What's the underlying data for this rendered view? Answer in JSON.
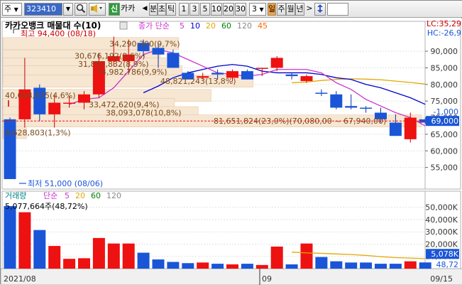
{
  "toolbar": {
    "market": "주",
    "code": "323410",
    "search_icon": "magnifier-icon",
    "speaker_icon": "speaker-icon",
    "new_badge": "신",
    "stock_name": "카카",
    "prev_arrow": "◀",
    "period_label": "분",
    "tick_label": "초",
    "tick2_label": "틱",
    "periods": [
      "1",
      "3",
      "5",
      "10",
      "20",
      "30"
    ],
    "count": "3",
    "day_label": "일",
    "week_label": "주",
    "month_label": "월",
    "year_label": "년",
    "next_arrow": ">",
    "updown_icon": "updown-arrow-icon"
  },
  "price_panel": {
    "title": "카카오뱅크 매물대 수(10)",
    "ma_label": "종가 단순",
    "ma_periods": [
      "5",
      "10",
      "20",
      "60",
      "120",
      "45"
    ],
    "ma_colors": [
      "#cc33cc",
      "#0000cc",
      "#e3a800",
      "#008000",
      "#888888",
      "#ff6600"
    ],
    "high_label": "최고 94,400 (08/18)",
    "low_label": "최저 51,000 (08/06)",
    "lc_label": "LC:35,29",
    "hc_label": "HC:-26,9",
    "cur_price": "69,000",
    "cur_diff": "-1,000",
    "cur_price_pct": "1,000"
  },
  "volume_profile": [
    {
      "label": "34,290,300(9,7%)",
      "value": 34290300,
      "price": 92300
    },
    {
      "label": "30,676,192(8,6%)",
      "value": 30676192,
      "price": 88600
    },
    {
      "label": "31,850,832(8,9%)",
      "value": 31850832,
      "price": 86200
    },
    {
      "label": "34,982,786(9,9%)",
      "value": 34982786,
      "price": 83800
    },
    {
      "label": "48,821,243(13,8%)",
      "value": 48821243,
      "price": 81000
    },
    {
      "label": "40,608,675(4,6%)",
      "value": 40608675,
      "price": 76700
    },
    {
      "label": "33,472,620(9,4%)",
      "value": 33472620,
      "price": 74000
    },
    {
      "label": "38,093,078(10,8%)",
      "value": 38093078,
      "price": 71500
    },
    {
      "label": "81,651,824(23,0%)(70,080,00 ~ 67,940,00)",
      "value": 81651824,
      "price": 69000
    },
    {
      "label": "4,628,803(1,3%)",
      "value": 4628803,
      "price": 65500
    }
  ],
  "volume_panel": {
    "title": "거래량",
    "ma_label": "단순",
    "ma_periods": [
      "5",
      "20",
      "60",
      "120"
    ],
    "ma_colors": [
      "#cc33cc",
      "#e3a800",
      "#008000",
      "#888888"
    ],
    "max_label": "5,077,664주(48,72%)",
    "cur_volume": "5,078K",
    "cur_pct": "48,72"
  },
  "x_axis": {
    "labels": [
      "2021/08",
      "09",
      "09/15"
    ]
  },
  "chart_data": {
    "type": "candlestick",
    "price_ticks": [
      "90,000",
      "85,000",
      "80,000",
      "75,000",
      "70,000",
      "65,000",
      "60,000",
      "55,000"
    ],
    "price_tick_values": [
      90000,
      85000,
      80000,
      75000,
      70000,
      65000,
      60000,
      55000
    ],
    "ylim_price": [
      51000,
      95500
    ],
    "volume_ticks": [
      "50,000K",
      "40,000K",
      "30,000K",
      "20,000K",
      "10,000K"
    ],
    "volume_tick_values": [
      50000,
      40000,
      30000,
      20000,
      10000
    ],
    "ylim_volume": [
      0,
      55000
    ],
    "candles": [
      {
        "o": 69500,
        "h": 70000,
        "l": 53000,
        "c": 51500,
        "v": 51000,
        "up": false
      },
      {
        "o": 69500,
        "h": 88000,
        "l": 67000,
        "c": 78500,
        "v": 46000,
        "up": true
      },
      {
        "o": 79000,
        "h": 80000,
        "l": 69000,
        "c": 71000,
        "v": 31500,
        "up": false
      },
      {
        "o": 71000,
        "h": 77000,
        "l": 67000,
        "c": 74500,
        "v": 18500,
        "up": true
      },
      {
        "o": 74500,
        "h": 76500,
        "l": 73000,
        "c": 74500,
        "v": 8000,
        "up": true
      },
      {
        "o": 74500,
        "h": 78000,
        "l": 72500,
        "c": 77000,
        "v": 8500,
        "up": true
      },
      {
        "o": 77000,
        "h": 89500,
        "l": 76000,
        "c": 87000,
        "v": 25000,
        "up": true
      },
      {
        "o": 87000,
        "h": 94400,
        "l": 85500,
        "c": 88500,
        "v": 20500,
        "up": true
      },
      {
        "o": 87000,
        "h": 93500,
        "l": 83500,
        "c": 89000,
        "v": 20500,
        "up": true
      },
      {
        "o": 92500,
        "h": 93500,
        "l": 88500,
        "c": 90000,
        "v": 13000,
        "up": false
      },
      {
        "o": 91000,
        "h": 92500,
        "l": 85000,
        "c": 89000,
        "v": 7500,
        "up": false
      },
      {
        "o": 89500,
        "h": 90500,
        "l": 85000,
        "c": 85000,
        "v": 5500,
        "up": false
      },
      {
        "o": 83500,
        "h": 84000,
        "l": 81500,
        "c": 81500,
        "v": 4500,
        "up": false
      },
      {
        "o": 82000,
        "h": 83500,
        "l": 81500,
        "c": 82500,
        "v": 5000,
        "up": true
      },
      {
        "o": 83500,
        "h": 84500,
        "l": 81500,
        "c": 83000,
        "v": 4000,
        "up": false
      },
      {
        "o": 82000,
        "h": 84500,
        "l": 81000,
        "c": 84000,
        "v": 3500,
        "up": true
      },
      {
        "o": 84000,
        "h": 84500,
        "l": 81500,
        "c": 81500,
        "v": 4000,
        "up": false
      },
      {
        "o": 85000,
        "h": 85000,
        "l": 82500,
        "c": 85000,
        "v": 3000,
        "up": true
      },
      {
        "o": 85000,
        "h": 88500,
        "l": 84000,
        "c": 88000,
        "v": 18000,
        "up": true
      },
      {
        "o": 83000,
        "h": 83500,
        "l": 81500,
        "c": 82500,
        "v": 3500,
        "up": false
      },
      {
        "o": 81000,
        "h": 83000,
        "l": 80500,
        "c": 82500,
        "v": 20500,
        "up": true
      },
      {
        "o": 77500,
        "h": 78500,
        "l": 76500,
        "c": 77500,
        "v": 9500,
        "up": false
      },
      {
        "o": 77000,
        "h": 78000,
        "l": 72500,
        "c": 73000,
        "v": 6000,
        "up": false
      },
      {
        "o": 73000,
        "h": 77000,
        "l": 72500,
        "c": 73500,
        "v": 5000,
        "up": false
      },
      {
        "o": 73000,
        "h": 73500,
        "l": 71500,
        "c": 73000,
        "v": 5000,
        "up": false
      },
      {
        "o": 71500,
        "h": 73000,
        "l": 68500,
        "c": 69500,
        "v": 4000,
        "up": false
      },
      {
        "o": 68500,
        "h": 71000,
        "l": 64500,
        "c": 64500,
        "v": 4000,
        "up": false
      },
      {
        "o": 63500,
        "h": 71500,
        "l": 62500,
        "c": 70000,
        "v": 6000,
        "up": true
      },
      {
        "o": 69500,
        "h": 70000,
        "l": 68000,
        "c": 68500,
        "v": 5078,
        "up": false
      }
    ],
    "ma5": [
      null,
      null,
      null,
      null,
      74000,
      75500,
      76000,
      79000,
      84000,
      89000,
      90500,
      89500,
      87500,
      85500,
      83500,
      83000,
      82500,
      83000,
      84500,
      84500,
      84500,
      83500,
      80500,
      78500,
      75500,
      73500,
      71500,
      70000,
      67500
    ],
    "ma10": [
      null,
      null,
      null,
      null,
      null,
      null,
      null,
      null,
      null,
      77500,
      79500,
      82000,
      83500,
      84500,
      85500,
      86000,
      85500,
      84000,
      83500,
      83500,
      83500,
      83000,
      82000,
      81500,
      80000,
      79000,
      77500,
      76000,
      74000
    ],
    "ma20": [
      null,
      null,
      null,
      null,
      null,
      null,
      null,
      null,
      null,
      null,
      null,
      null,
      null,
      null,
      null,
      null,
      null,
      null,
      null,
      80500,
      80700,
      81200,
      81500,
      81700,
      81600,
      81400,
      81000,
      80600,
      80100
    ],
    "vol_ma20": [
      null,
      null,
      null,
      null,
      null,
      null,
      null,
      null,
      null,
      null,
      null,
      null,
      null,
      null,
      null,
      null,
      null,
      null,
      null,
      13500,
      12800,
      12500,
      12000,
      11500,
      10800,
      9800,
      9000,
      8600,
      8200
    ]
  }
}
